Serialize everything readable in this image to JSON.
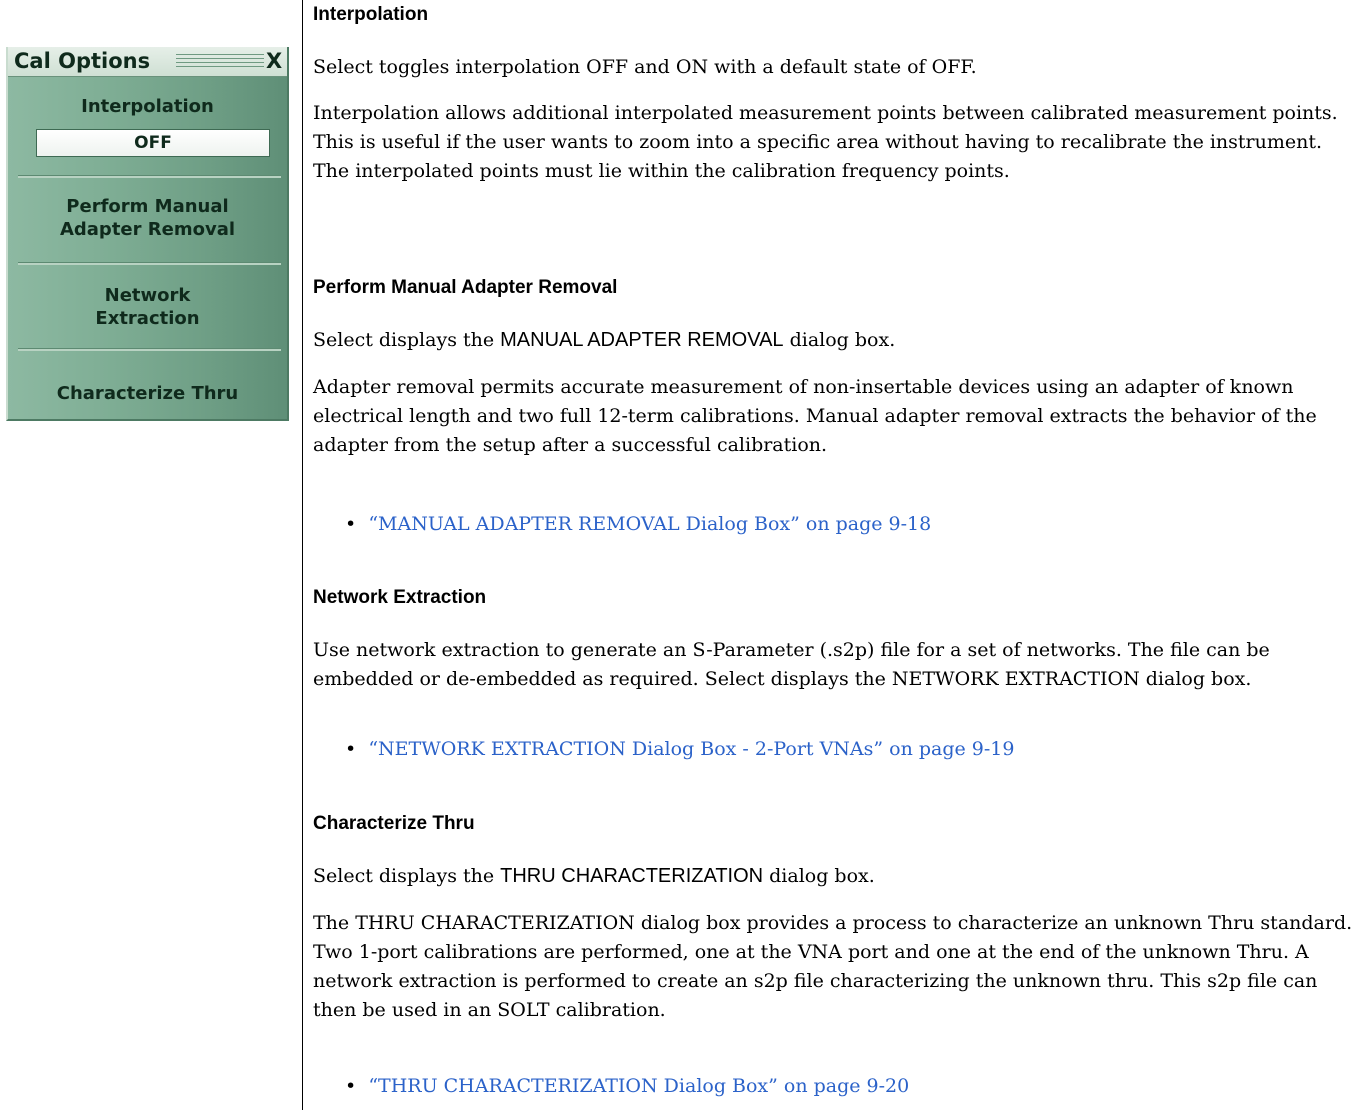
{
  "panel": {
    "title": "Cal Options",
    "close": "X",
    "interpolation_label": "Interpolation",
    "interpolation_value": "OFF",
    "items": [
      {
        "line1": "Perform Manual",
        "line2": "Adapter Removal"
      },
      {
        "line1": "Network",
        "line2": "Extraction"
      },
      {
        "line1": "Characterize Thru"
      }
    ]
  },
  "sections": {
    "interpolation": {
      "heading": "Interpolation",
      "p1": "Select toggles interpolation OFF and ON with a default state of OFF.",
      "p2": "Interpolation allows additional interpolated measurement points between calibrated measurement points. This is useful if the user wants to zoom into a specific area without having to recalibrate the instrument. The interpolated points must lie within the calibration frequency points."
    },
    "adapter": {
      "heading": "Perform Manual Adapter Removal",
      "p1_pre": "Select displays the ",
      "p1_dialog": "MANUAL ADAPTER REMOVAL",
      "p1_post": " dialog box.",
      "p2": "Adapter removal permits accurate measurement of non-insertable devices using an adapter of known electrical length and two full 12-term calibrations. Manual adapter removal extracts the behavior of the adapter from the setup after a successful calibration.",
      "link": "“MANUAL ADAPTER REMOVAL Dialog Box” on page 9-18"
    },
    "network": {
      "heading": "Network Extraction",
      "p1": "Use network extraction to generate an S-Parameter (.s2p) file for a set of networks. The file can be embedded or de-embedded as required. Select displays the NETWORK EXTRACTION dialog box.",
      "link": "“NETWORK EXTRACTION Dialog Box - 2-Port VNAs” on page 9-19"
    },
    "thru": {
      "heading": "Characterize Thru",
      "p1_pre": "Select displays the ",
      "p1_dialog": "THRU CHARACTERIZATION",
      "p1_post": " dialog box.",
      "p2": "The THRU CHARACTERIZATION dialog box provides a process to characterize an unknown Thru standard. Two 1-port calibrations are performed, one at the VNA port and one at the end of the unknown Thru. A network extraction is performed to create an s2p file characterizing the unknown thru. This s2p file can then be used in an SOLT calibration.",
      "link": "“THRU CHARACTERIZATION Dialog Box” on page 9-20"
    },
    "bullet_char": "•"
  }
}
